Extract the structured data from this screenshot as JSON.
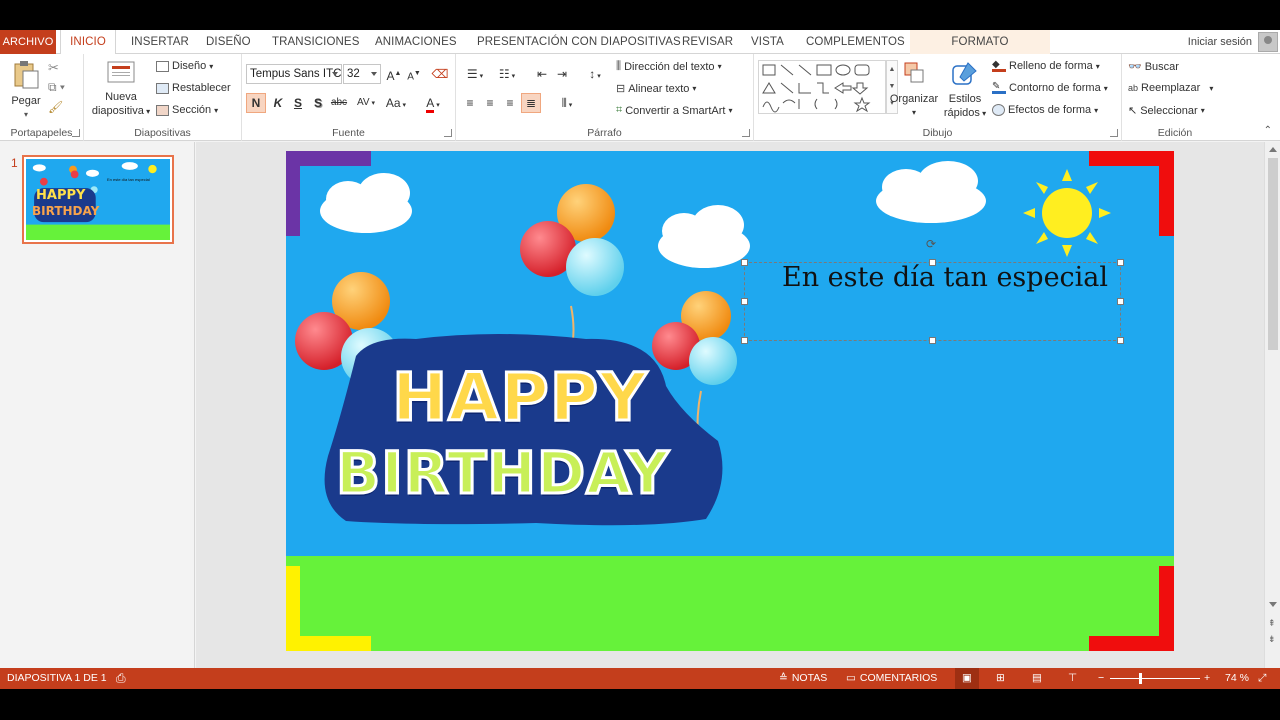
{
  "tabs": {
    "file": "ARCHIVO",
    "home": "INICIO",
    "insert": "INSERTAR",
    "design": "DISEÑO",
    "transitions": "TRANSICIONES",
    "animations": "ANIMACIONES",
    "slideshow": "PRESENTACIÓN CON DIAPOSITIVAS",
    "review": "REVISAR",
    "view": "VISTA",
    "addins": "COMPLEMENTOS",
    "format": "FORMATO",
    "signin": "Iniciar sesión"
  },
  "ribbon": {
    "clipboard": {
      "label": "Portapapeles",
      "paste": "Pegar"
    },
    "slides": {
      "label": "Diapositivas",
      "new_slide_1": "Nueva",
      "new_slide_2": "diapositiva",
      "layout": "Diseño",
      "reset": "Restablecer",
      "section": "Sección"
    },
    "font": {
      "label": "Fuente",
      "font_name": "Tempus Sans ITC",
      "font_size": "32",
      "bold": "N",
      "italic": "K",
      "underline": "S",
      "shadow": "S",
      "strike": "abc",
      "spacing": "AV",
      "case": "Aa"
    },
    "paragraph": {
      "label": "Párrafo",
      "text_direction": "Dirección del texto",
      "align_text": "Alinear texto",
      "smartart": "Convertir a SmartArt"
    },
    "drawing": {
      "label": "Dibujo",
      "arrange": "Organizar",
      "quick_styles_1": "Estilos",
      "quick_styles_2": "rápidos",
      "shape_fill": "Relleno de forma",
      "shape_outline": "Contorno de forma",
      "shape_effects": "Efectos de forma"
    },
    "editing": {
      "label": "Edición",
      "find": "Buscar",
      "replace": "Reemplazar",
      "select": "Seleccionar"
    }
  },
  "thumbnails": {
    "number": "1",
    "mini_title": "En este día tan especial"
  },
  "slide": {
    "text": "En este día tan especial",
    "happy": "HAPPY",
    "birthday": "BIRTHDAY",
    "sky_color": "#1fa8ef",
    "grass_color": "#66f23a"
  },
  "status": {
    "slide_info": "DIAPOSITIVA 1 DE 1",
    "notes": "NOTAS",
    "comments": "COMENTARIOS",
    "zoom": "74 %"
  },
  "colors": {
    "accent": "#c43e1c"
  }
}
